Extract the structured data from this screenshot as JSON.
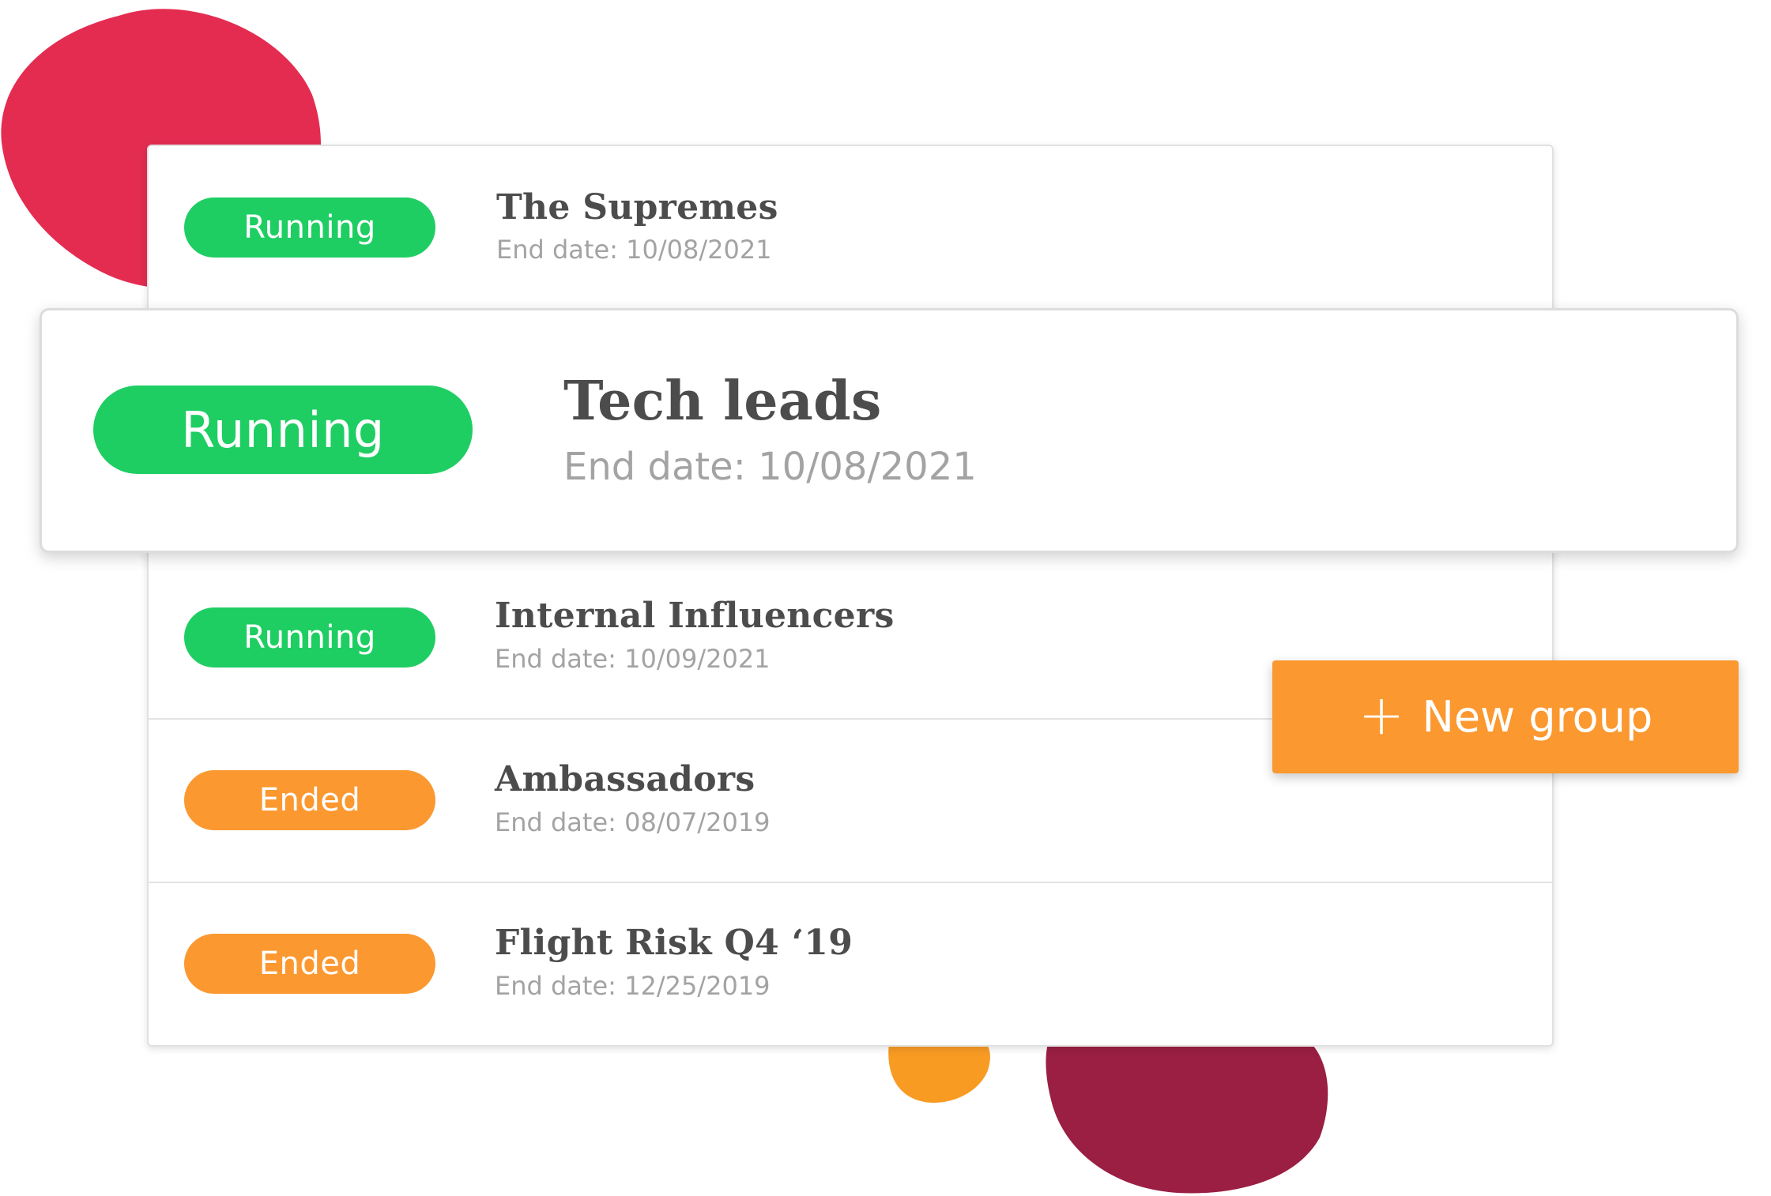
{
  "featured": {
    "status": "Running",
    "name": "Tech leads",
    "end_date": "End date: 10/08/2021"
  },
  "groups": [
    {
      "status": "Running",
      "name": "The Supremes",
      "end_date": "End date: 10/08/2021"
    },
    {
      "status": "Running",
      "name": "Internal Influencers",
      "end_date": "End date: 10/09/2021"
    },
    {
      "status": "Ended",
      "name": "Ambassadors",
      "end_date": "End date: 08/07/2019"
    },
    {
      "status": "Ended",
      "name": "Flight Risk Q4 ‘19",
      "end_date": "End date: 12/25/2019"
    }
  ],
  "new_group_button": {
    "icon": "plus-icon",
    "label": "New group"
  },
  "colors": {
    "running": "#1fce63",
    "ended": "#fb9830",
    "blob_red": "#e42c51",
    "blob_orange": "#f89b23",
    "blob_maroon": "#9a1f42"
  }
}
